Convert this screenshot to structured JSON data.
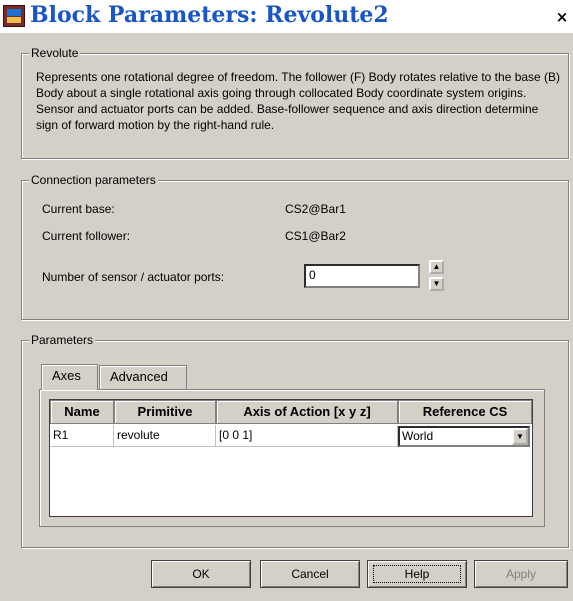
{
  "window": {
    "title": "Block Parameters: Revolute2",
    "close_glyph": "×"
  },
  "revolute": {
    "legend": "Revolute",
    "description": "Represents one rotational degree of freedom. The follower (F) Body rotates relative to the base (B) Body about a single rotational axis going through collocated Body coordinate system origins. Sensor and actuator ports can be added. Base-follower sequence and axis direction determine sign of forward motion by the right-hand rule."
  },
  "connection": {
    "legend": "Connection parameters",
    "current_base_label": "Current base:",
    "current_base_value": "CS2@Bar1",
    "current_follower_label": "Current follower:",
    "current_follower_value": "CS1@Bar2",
    "ports_label": "Number of sensor / actuator ports:",
    "ports_value": "0"
  },
  "parameters": {
    "legend": "Parameters",
    "tabs": [
      {
        "label": "Axes",
        "active": true
      },
      {
        "label": "Advanced",
        "active": false
      }
    ],
    "table": {
      "headers": [
        "Name",
        "Primitive",
        "Axis of Action [x y z]",
        "Reference CS"
      ],
      "rows": [
        {
          "name": "R1",
          "primitive": "revolute",
          "axis": "[0 0 1]",
          "reference": "World"
        }
      ]
    }
  },
  "buttons": {
    "ok": "OK",
    "cancel": "Cancel",
    "help": "Help",
    "apply": "Apply"
  },
  "icons": {
    "window_icon": "simulink-block-icon",
    "spin_up": "▲",
    "spin_down": "▼",
    "combo_arrow": "▼"
  }
}
